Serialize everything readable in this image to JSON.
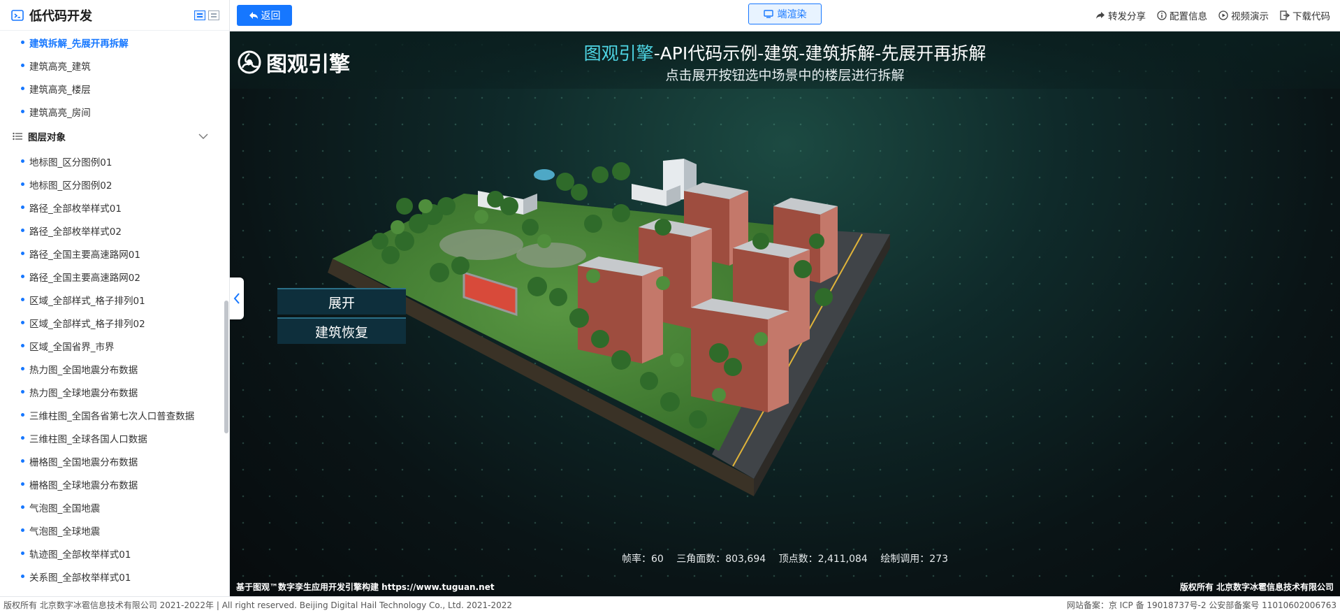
{
  "sidebar": {
    "title": "低代码开发",
    "items_top": [
      {
        "label": "建筑拆解_先展开再拆解",
        "active": true
      },
      {
        "label": "建筑高亮_建筑"
      },
      {
        "label": "建筑高亮_楼层"
      },
      {
        "label": "建筑高亮_房间"
      }
    ],
    "group_label": "图层对象",
    "items": [
      "地标图_区分图例01",
      "地标图_区分图例02",
      "路径_全部枚举样式01",
      "路径_全部枚举样式02",
      "路径_全国主要高速路网01",
      "路径_全国主要高速路网02",
      "区域_全部样式_格子排列01",
      "区域_全部样式_格子排列02",
      "区域_全国省界_市界",
      "热力图_全国地震分布数据",
      "热力图_全球地震分布数据",
      "三维柱图_全国各省第七次人口普查数据",
      "三维柱图_全球各国人口数据",
      "栅格图_全国地震分布数据",
      "栅格图_全球地震分布数据",
      "气泡图_全国地震",
      "气泡图_全球地震",
      "轨迹图_全部枚举样式01",
      "关系图_全部枚举样式01"
    ]
  },
  "topbar": {
    "back": "返回",
    "render": "端渲染",
    "actions": {
      "share": "转发分享",
      "config": "配置信息",
      "video": "视频演示",
      "download": "下载代码"
    }
  },
  "viewport": {
    "logo": "图观引擎",
    "title_accent": "图观引擎",
    "title_rest": "-API代码示例-建筑-建筑拆解-先展开再拆解",
    "subtitle": "点击展开按钮选中场景中的楼层进行拆解",
    "btn_expand": "展开",
    "btn_restore": "建筑恢复",
    "stats": {
      "fps": "帧率：60",
      "triangles": "三角面数：803,694",
      "vertices": "顶点数：2,411,084",
      "drawcalls": "绘制调用：273"
    },
    "footer_left": "基于图观™数字孪生应用开发引擎构建 https://www.tuguan.net",
    "footer_right": "版权所有 北京数字冰雹信息技术有限公司"
  },
  "footer": {
    "left": "版权所有 北京数字冰雹信息技术有限公司 2021-2022年 | All right reserved. Beijing Digital Hail Technology Co., Ltd. 2021-2022",
    "right": "网站备案：京 ICP 备 19018737号-2 公安部备案号 11010602006763"
  },
  "colors": {
    "accent": "#1677ff",
    "title_accent": "#4fd7e6"
  }
}
